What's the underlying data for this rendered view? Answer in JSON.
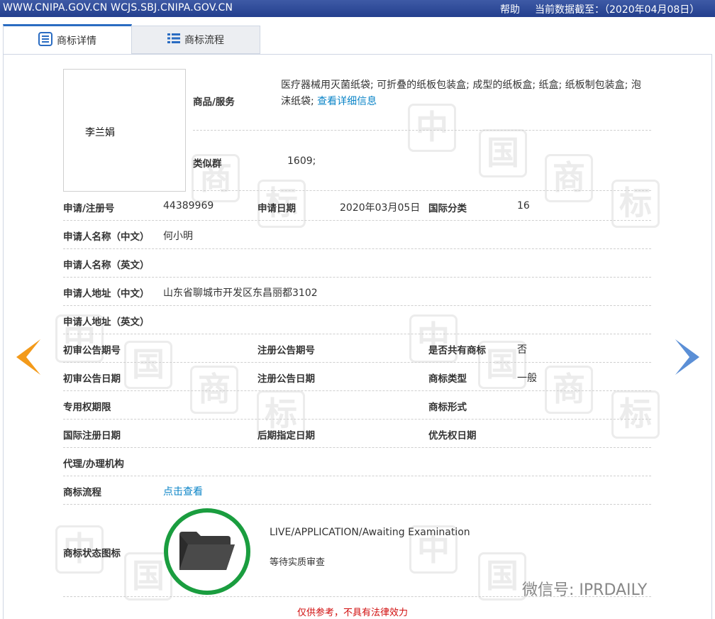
{
  "topbar": {
    "urls": "WWW.CNIPA.GOV.CN WCJS.SBJ.CNIPA.GOV.CN",
    "help": "帮助",
    "asof_label": "当前数据截至：",
    "asof_date": "（2020年04月08日）"
  },
  "tabs": [
    {
      "label": "商标详情",
      "icon": "document-list-icon",
      "active": true
    },
    {
      "label": "商标流程",
      "icon": "list-icon",
      "active": false
    }
  ],
  "trademark_image_text": "李兰娟",
  "goods": {
    "label": "商品/服务",
    "value": "医疗器械用灭菌纸袋; 可折叠的纸板包装盒; 成型的纸板盒; 纸盒; 纸板制包装盒; 泡沫纸袋;",
    "link": "查看详细信息"
  },
  "similar_group": {
    "label": "类似群",
    "value": "1609;"
  },
  "rows": {
    "reg_no": {
      "label": "申请/注册号",
      "value": "44389969"
    },
    "app_date": {
      "label": "申请日期",
      "value": "2020年03月05日"
    },
    "intl_class": {
      "label": "国际分类",
      "value": "16"
    },
    "applicant_cn": {
      "label": "申请人名称（中文）",
      "value": "何小明"
    },
    "applicant_en": {
      "label": "申请人名称（英文）",
      "value": ""
    },
    "address_cn": {
      "label": "申请人地址（中文）",
      "value": "山东省聊城市开发区东昌丽都3102"
    },
    "address_en": {
      "label": "申请人地址（英文）",
      "value": ""
    },
    "prelim_pub_no": {
      "label": "初审公告期号",
      "value": ""
    },
    "reg_pub_no": {
      "label": "注册公告期号",
      "value": ""
    },
    "shared_mark": {
      "label": "是否共有商标",
      "value": "否"
    },
    "prelim_pub_date": {
      "label": "初审公告日期",
      "value": ""
    },
    "reg_pub_date": {
      "label": "注册公告日期",
      "value": ""
    },
    "mark_type": {
      "label": "商标类型",
      "value": "一般"
    },
    "exclusive_period": {
      "label": "专用权期限",
      "value": ""
    },
    "mark_form": {
      "label": "商标形式",
      "value": ""
    },
    "intl_reg_date": {
      "label": "国际注册日期",
      "value": ""
    },
    "later_designation": {
      "label": "后期指定日期",
      "value": ""
    },
    "priority_date": {
      "label": "优先权日期",
      "value": ""
    },
    "agent": {
      "label": "代理/办理机构",
      "value": ""
    },
    "process": {
      "label": "商标流程",
      "link": "点击查看"
    },
    "status_icon": {
      "label": "商标状态图标"
    }
  },
  "status": {
    "en": "LIVE/APPLICATION/Awaiting Examination",
    "cn": "等待实质审查",
    "icon": "folder-icon",
    "ring_color": "#1a9d3f"
  },
  "footer_note": "仅供参考，不具有法律效力",
  "wechat_watermark": "微信号: IPRDAILY",
  "colors": {
    "topbar": "#233f8e",
    "link": "#0b84c7",
    "prev_arrow": "#f39a1a",
    "next_arrow": "#5b8fd6",
    "note": "#d10c0c"
  }
}
